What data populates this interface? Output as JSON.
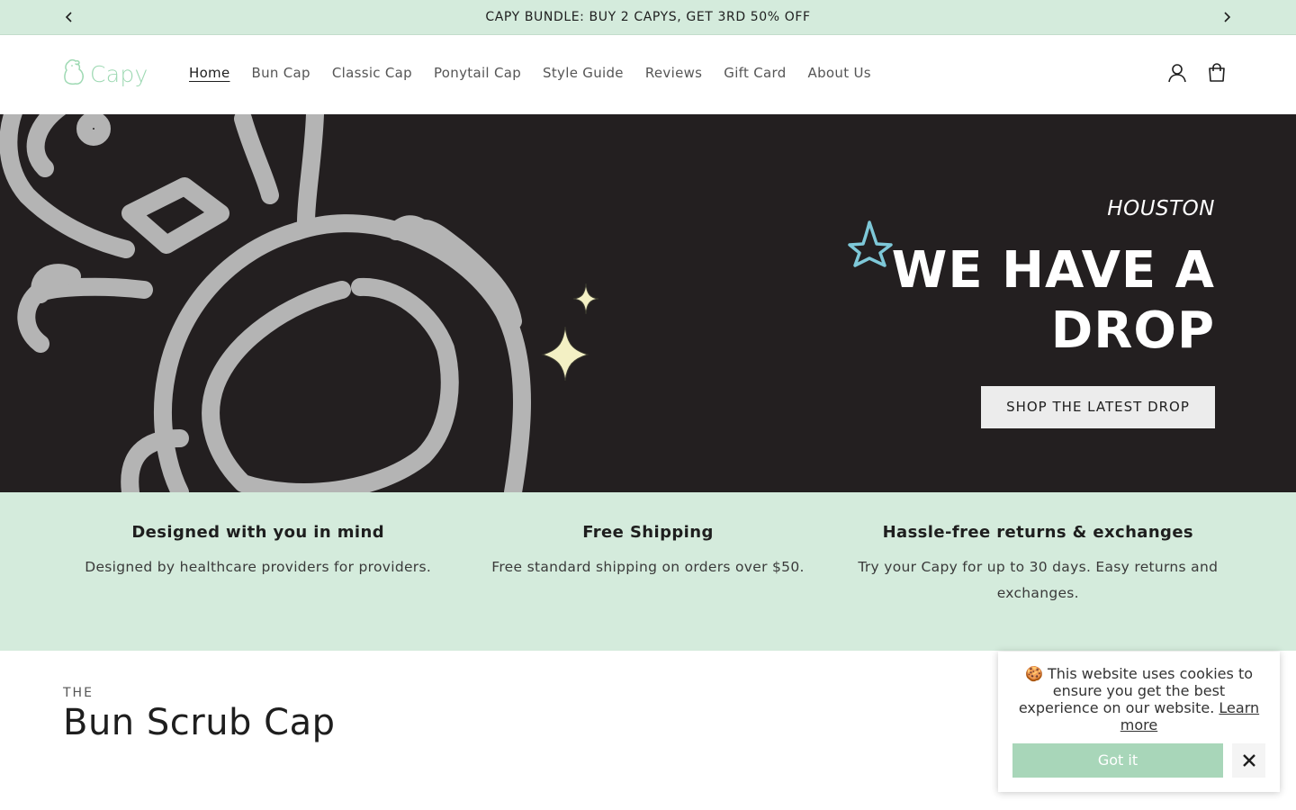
{
  "announcement": {
    "text": "CAPY BUNDLE: BUY 2 CAPYS, GET 3RD 50% OFF",
    "prev_icon": "chevron-left-icon",
    "next_icon": "chevron-right-icon"
  },
  "header": {
    "logo_text": "Capy",
    "nav": [
      {
        "label": "Home",
        "active": true
      },
      {
        "label": "Bun Cap"
      },
      {
        "label": "Classic Cap"
      },
      {
        "label": "Ponytail Cap"
      },
      {
        "label": "Style Guide"
      },
      {
        "label": "Reviews"
      },
      {
        "label": "Gift Card"
      },
      {
        "label": "About Us"
      }
    ],
    "icons": [
      "account-icon",
      "cart-icon"
    ]
  },
  "hero": {
    "subtitle": "HOUSTON",
    "title_line1": "WE HAVE A",
    "title_line2": "DROP",
    "button_label": "SHOP THE LATEST DROP",
    "background": "#231f20"
  },
  "features": [
    {
      "title": "Designed with you in mind",
      "text": "Designed by healthcare providers for providers."
    },
    {
      "title": "Free Shipping",
      "text": "Free standard shipping on orders over $50."
    },
    {
      "title": "Hassle-free returns & exchanges",
      "text": "Try your Capy for up to 30 days. Easy returns and exchanges."
    }
  ],
  "product_section": {
    "eyebrow": "THE",
    "title": "Bun Scrub Cap"
  },
  "cookie": {
    "emoji": "🍪",
    "message": "This website uses cookies to ensure you get the best experience on our website.",
    "link_label": "Learn more",
    "accept_label": "Got it",
    "close_icon": "close-icon"
  },
  "colors": {
    "mint": "#d4ebdc",
    "logo_green": "#9ed9b3",
    "button_green": "#a8d6b9",
    "hero_dark": "#231f20",
    "star_blue": "#7ec8d8",
    "sparkle_yellow": "#f3f0c4"
  }
}
